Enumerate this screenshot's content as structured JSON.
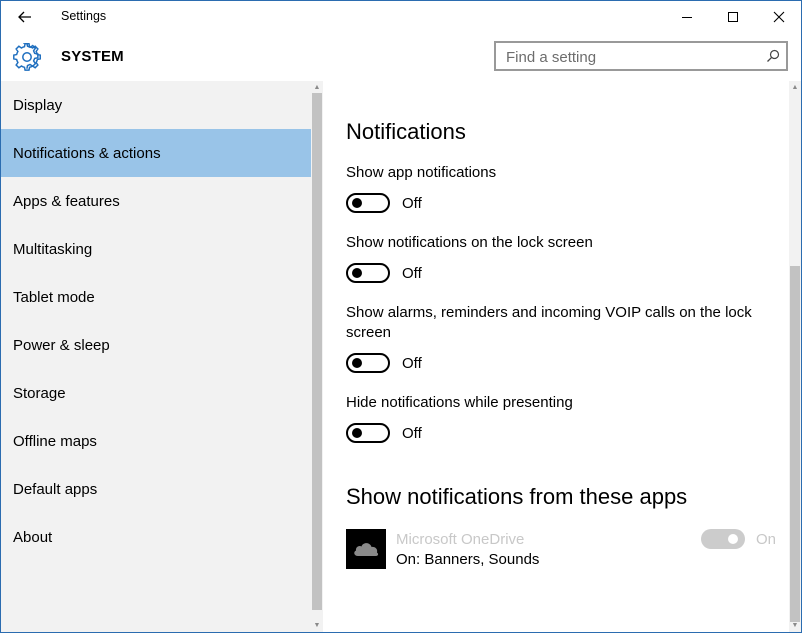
{
  "window": {
    "title": "Settings",
    "controls": [
      "minimize",
      "maximize",
      "close"
    ]
  },
  "header": {
    "section": "SYSTEM",
    "icon": "gear-icon",
    "accent": "#1f6fbf"
  },
  "search": {
    "placeholder": "Find a setting",
    "value": ""
  },
  "sidebar": {
    "selected_color": "#99c4e8",
    "items": [
      {
        "label": "Display"
      },
      {
        "label": "Notifications & actions",
        "selected": true
      },
      {
        "label": "Apps & features"
      },
      {
        "label": "Multitasking"
      },
      {
        "label": "Tablet mode"
      },
      {
        "label": "Power & sleep"
      },
      {
        "label": "Storage"
      },
      {
        "label": "Offline maps"
      },
      {
        "label": "Default apps"
      },
      {
        "label": "About"
      }
    ]
  },
  "main": {
    "notifications_heading": "Notifications",
    "settings": [
      {
        "label": "Show app notifications",
        "state": "Off"
      },
      {
        "label": "Show notifications on the lock screen",
        "state": "Off"
      },
      {
        "label": "Show alarms, reminders and incoming VOIP calls on the lock screen",
        "state": "Off"
      },
      {
        "label": "Hide notifications while presenting",
        "state": "Off"
      }
    ],
    "apps_heading": "Show notifications from these apps",
    "apps": [
      {
        "name": "Microsoft OneDrive",
        "detail": "On: Banners, Sounds",
        "state": "On",
        "icon": "onedrive-icon"
      }
    ]
  }
}
